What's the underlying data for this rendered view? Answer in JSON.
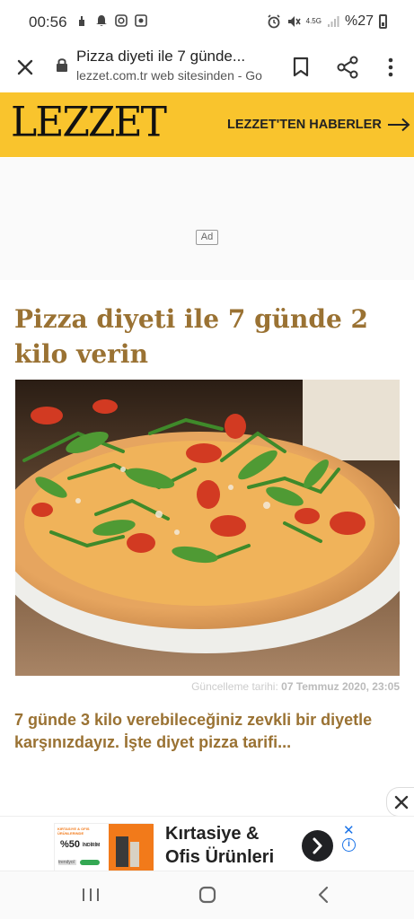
{
  "status": {
    "time": "00:56",
    "network": "4.5G",
    "battery": "%27"
  },
  "toolbar": {
    "page_title": "Pizza diyeti ile 7 günde...",
    "url_text": "lezzet.com.tr web sitesinden - Go"
  },
  "site": {
    "logo": "LEZZET",
    "news_link": "LEZZET'TEN HABERLER"
  },
  "ad": {
    "label": "Ad"
  },
  "article": {
    "title": "Pizza diyeti ile 7 günde 2 kilo verin",
    "updated_label": "Güncelleme tarihi:",
    "updated_date": "07 Temmuz 2020, 23:05",
    "lead": "7 günde 3 kilo verebileceğiniz zevkli bir diyetle karşınızdayız. İşte diyet pizza tarifi..."
  },
  "banner": {
    "title_line1": "Kırtasiye &",
    "title_line2": "Ofis Ürünleri",
    "img_top_text": "KIRTASIYE & OFIS ÜRÜNLERINDE",
    "img_discount": "%50",
    "img_discount_word": "İNDİRİM",
    "img_brand": "trendyol"
  },
  "colors": {
    "header_yellow": "#f9c42d",
    "headline_brown": "#9a7233"
  }
}
